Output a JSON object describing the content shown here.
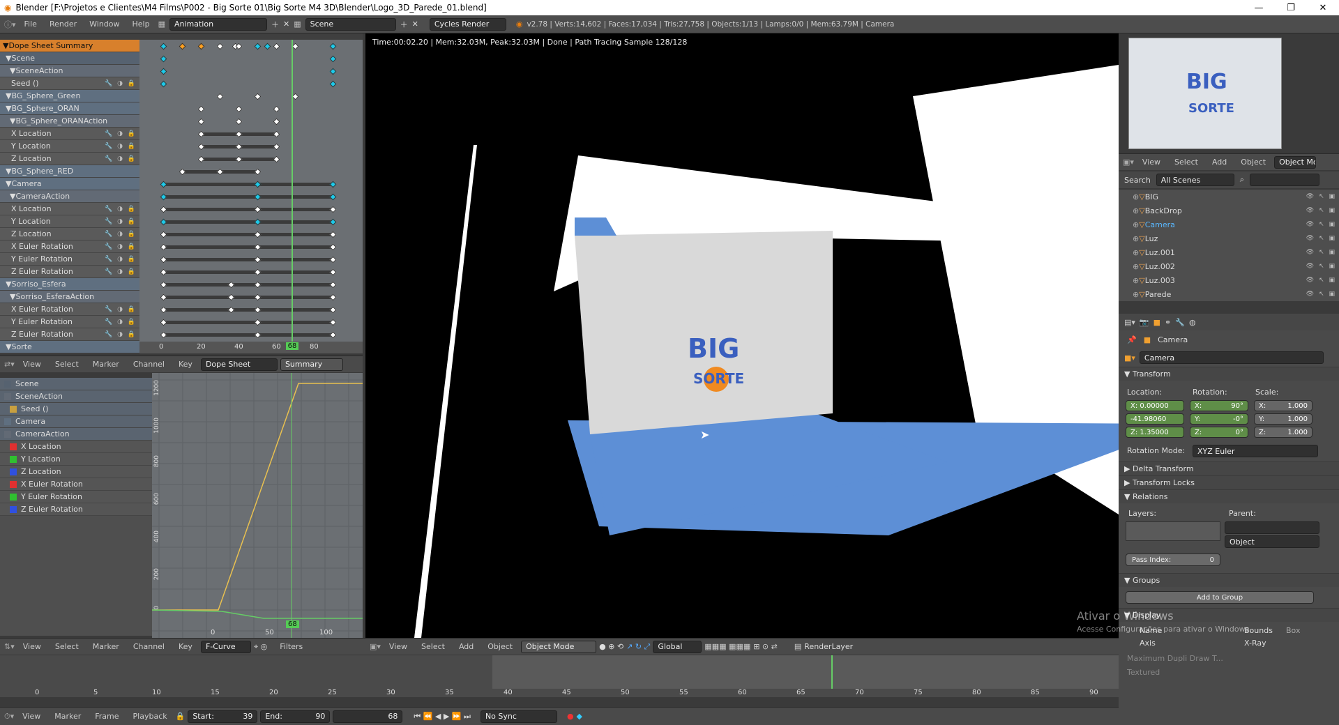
{
  "window": {
    "title": "Blender [F:\\Projetos e Clientes\\M4 Films\\P002 - Big Sorte 01\\Big Sorte M4 3D\\Blender\\Logo_3D_Parede_01.blend]",
    "min": "—",
    "max": "❐",
    "close": "✕"
  },
  "topbar": {
    "menus": [
      "File",
      "Render",
      "Window",
      "Help"
    ],
    "layout": "Animation",
    "scene": "Scene",
    "engine": "Cycles Render",
    "stats": "v2.78 | Verts:14,602 | Faces:17,034 | Tris:27,758 | Objects:1/13 | Lamps:0/0 | Mem:63.79M | Camera"
  },
  "dopesheet": {
    "channels": [
      {
        "name": "Dope Sheet Summary",
        "type": "orange"
      },
      {
        "name": "Scene",
        "type": "scene"
      },
      {
        "name": "SceneAction",
        "type": "act"
      },
      {
        "name": "Seed ()",
        "type": "ch"
      },
      {
        "name": "BG_Sphere_Green",
        "type": "obj"
      },
      {
        "name": "BG_Sphere_ORAN",
        "type": "obj"
      },
      {
        "name": "BG_Sphere_ORANAction",
        "type": "act"
      },
      {
        "name": "X Location",
        "type": "ch"
      },
      {
        "name": "Y Location",
        "type": "ch"
      },
      {
        "name": "Z Location",
        "type": "ch"
      },
      {
        "name": "BG_Sphere_RED",
        "type": "obj"
      },
      {
        "name": "Camera",
        "type": "obj"
      },
      {
        "name": "CameraAction",
        "type": "act"
      },
      {
        "name": "X Location",
        "type": "ch"
      },
      {
        "name": "Y Location",
        "type": "ch"
      },
      {
        "name": "Z Location",
        "type": "ch"
      },
      {
        "name": "X Euler Rotation",
        "type": "ch"
      },
      {
        "name": "Y Euler Rotation",
        "type": "ch"
      },
      {
        "name": "Z Euler Rotation",
        "type": "ch"
      },
      {
        "name": "Sorriso_Esfera",
        "type": "obj"
      },
      {
        "name": "Sorriso_EsferaAction",
        "type": "act"
      },
      {
        "name": "X Euler Rotation",
        "type": "ch"
      },
      {
        "name": "Y Euler Rotation",
        "type": "ch"
      },
      {
        "name": "Z Euler Rotation",
        "type": "ch"
      },
      {
        "name": "Sorte",
        "type": "obj"
      }
    ],
    "ruler": [
      "0",
      "20",
      "40",
      "60",
      "80"
    ],
    "current_frame": "68",
    "header": {
      "menus": [
        "View",
        "Select",
        "Marker",
        "Channel",
        "Key"
      ],
      "mode": "Dope Sheet",
      "summary": "Summary"
    }
  },
  "graph": {
    "channels": [
      {
        "name": "Scene",
        "color": "#566270"
      },
      {
        "name": "SceneAction",
        "color": "#626a75"
      },
      {
        "name": "Seed ()",
        "color": "#c8a040"
      },
      {
        "name": "Camera",
        "color": "#5f6f80"
      },
      {
        "name": "CameraAction",
        "color": "#626a75"
      },
      {
        "name": "X Location",
        "color": "#e03030"
      },
      {
        "name": "Y Location",
        "color": "#30c030"
      },
      {
        "name": "Z Location",
        "color": "#3050e0"
      },
      {
        "name": "X Euler Rotation",
        "color": "#e03030"
      },
      {
        "name": "Y Euler Rotation",
        "color": "#30c030"
      },
      {
        "name": "Z Euler Rotation",
        "color": "#3050e0"
      }
    ],
    "yticks": [
      "1200",
      "1000",
      "800",
      "600",
      "400",
      "200",
      "0"
    ],
    "xticks": [
      "0",
      "50",
      "100"
    ],
    "current_frame": "68",
    "header": {
      "menus": [
        "View",
        "Select",
        "Marker",
        "Channel",
        "Key"
      ],
      "mode": "F-Curve",
      "filters": "Filters"
    }
  },
  "viewport": {
    "info": "Time:00:02.20 | Mem:32.03M, Peak:32.03M | Done | Path Tracing Sample 128/128",
    "logo_top": "BIG",
    "logo_bottom": "SORTE",
    "header": {
      "menus": [
        "View",
        "Select",
        "Add",
        "Object"
      ],
      "mode": "Object Mode",
      "orientation": "Global",
      "renderlayer": "RenderLayer"
    }
  },
  "outliner": {
    "header": {
      "menus": [
        "View",
        "Select",
        "Add",
        "Object"
      ],
      "mode": "Object Mode"
    },
    "search_label": "Search",
    "search_value": "All Scenes",
    "items": [
      {
        "name": "BIG",
        "selected": false
      },
      {
        "name": "BackDrop",
        "selected": false
      },
      {
        "name": "Camera",
        "selected": true
      },
      {
        "name": "Luz",
        "selected": false
      },
      {
        "name": "Luz.001",
        "selected": false
      },
      {
        "name": "Luz.002",
        "selected": false
      },
      {
        "name": "Luz.003",
        "selected": false
      },
      {
        "name": "Parede",
        "selected": false
      }
    ]
  },
  "properties": {
    "breadcrumb": "Camera",
    "object_name": "Camera",
    "transform": {
      "title": "Transform",
      "location_label": "Location:",
      "rotation_label": "Rotation:",
      "scale_label": "Scale:",
      "loc": [
        "X: 0.00000",
        "-41.98060",
        "Z: 1.35000"
      ],
      "rot": [
        {
          "k": "X:",
          "v": "90°"
        },
        {
          "k": "Y:",
          "v": "-0°"
        },
        {
          "k": "Z:",
          "v": "0°"
        }
      ],
      "scale": [
        {
          "k": "X:",
          "v": "1.000"
        },
        {
          "k": "Y:",
          "v": "1.000"
        },
        {
          "k": "Z:",
          "v": "1.000"
        }
      ],
      "rotation_mode_label": "Rotation Mode:",
      "rotation_mode": "XYZ Euler"
    },
    "delta": "Delta Transform",
    "locks": "Transform Locks",
    "relations": {
      "title": "Relations",
      "layers": "Layers:",
      "parent": "Parent:",
      "parent_type": "Object",
      "pass_index": "Pass Index:",
      "pass_value": "0"
    },
    "groups": {
      "title": "Groups",
      "add": "Add to Group"
    },
    "display": {
      "title": "Display",
      "name": "Name",
      "bounds": "Bounds",
      "bounds_type": "Box",
      "axis": "Axis",
      "xray": "X-Ray",
      "max_draw": "Maximum Dupli Draw T...",
      "textured": "Textured"
    },
    "watermark1": "Ativar o Windows",
    "watermark2": "Acesse Configurações para ativar o Windows."
  },
  "timeline": {
    "ticks": [
      "0",
      "5",
      "10",
      "15",
      "20",
      "25",
      "30",
      "35",
      "40",
      "45",
      "50",
      "55",
      "60",
      "65",
      "70",
      "75",
      "80",
      "85",
      "90"
    ],
    "menus": [
      "View",
      "Marker",
      "Frame",
      "Playback"
    ],
    "start_label": "Start:",
    "start": "39",
    "end_label": "End:",
    "end": "90",
    "current": "68",
    "sync": "No Sync"
  }
}
